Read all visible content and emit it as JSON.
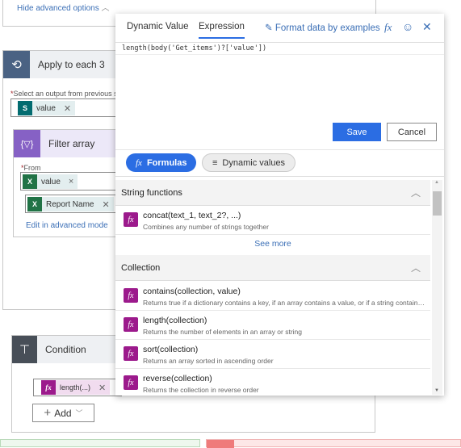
{
  "top_card": {
    "hide_advanced": "Hide advanced options"
  },
  "apply_each": {
    "title": "Apply to each 3",
    "select_label": "Select an output from previous steps",
    "chip": "value"
  },
  "filter_array": {
    "title": "Filter array",
    "from_label": "From",
    "chip1": "value",
    "chip2": "Report Name",
    "edit_link": "Edit in advanced mode"
  },
  "condition": {
    "title": "Condition",
    "chip": "length(...)",
    "add_label": "Add"
  },
  "popup": {
    "tabs": [
      "Dynamic Value",
      "Expression"
    ],
    "active_tab": "Expression",
    "format_link": "Format data by examples",
    "expression": "length(body('Get_items')?['value'])",
    "save": "Save",
    "cancel": "Cancel",
    "formulas": "Formulas",
    "dynamic_values": "Dynamic values",
    "sections": [
      {
        "title": "String functions",
        "items": [
          {
            "name": "concat(text_1, text_2?, ...)",
            "desc": "Combines any number of strings together"
          }
        ],
        "see_more": "See more"
      },
      {
        "title": "Collection",
        "items": [
          {
            "name": "contains(collection, value)",
            "desc": "Returns true if a dictionary contains a key, if an array contains a value, or if a string contains a substring"
          },
          {
            "name": "length(collection)",
            "desc": "Returns the number of elements in an array or string"
          },
          {
            "name": "sort(collection)",
            "desc": "Returns an array sorted in ascending order"
          },
          {
            "name": "reverse(collection)",
            "desc": "Returns the collection in reverse order"
          }
        ]
      }
    ]
  },
  "colors": {
    "accent": "#2b6de3",
    "fx": "#9c1a8c",
    "apply_icon": "#4a6283",
    "filter_icon": "#8661c5",
    "condition_icon": "#484f58"
  }
}
